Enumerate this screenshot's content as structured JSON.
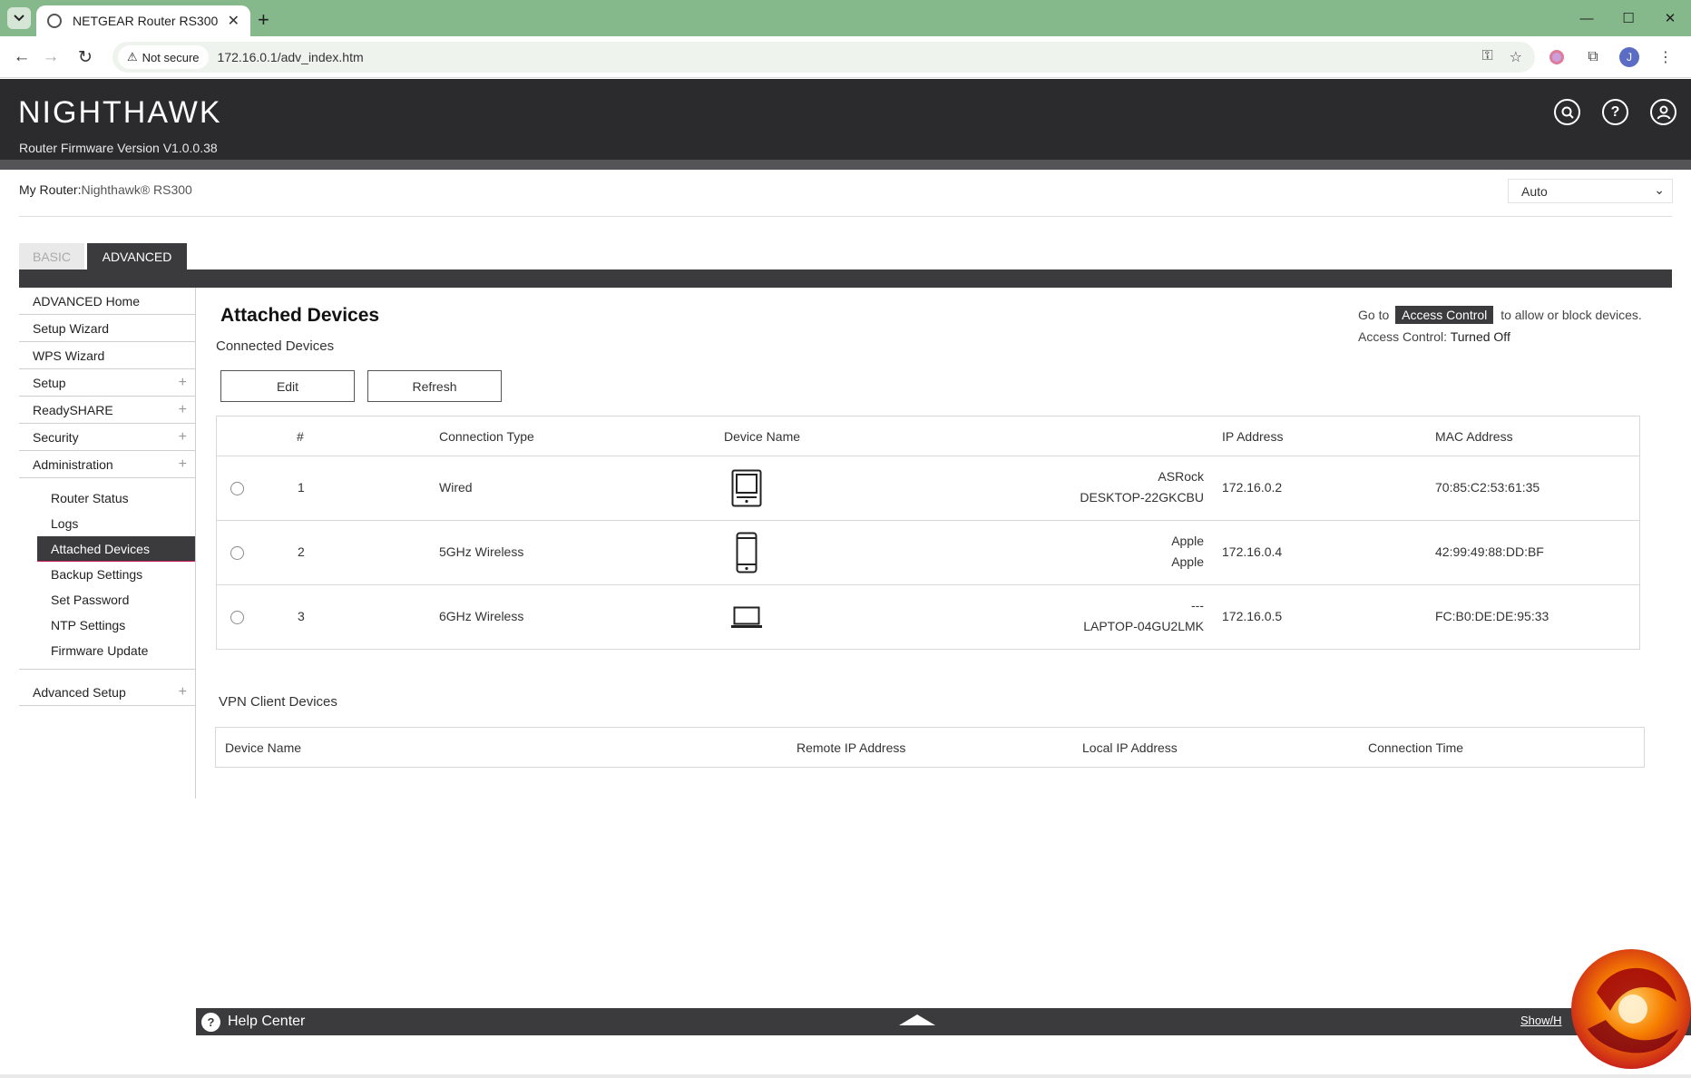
{
  "browser": {
    "tab_title": "NETGEAR Router RS300",
    "security_label": "Not secure",
    "url": "172.16.0.1/adv_index.htm",
    "profile_initial": "J"
  },
  "header": {
    "logo": "NIGHTHAWK",
    "firmware": "Router Firmware Version V1.0.0.38"
  },
  "router_info": {
    "label": "My Router:",
    "name": "Nighthawk® RS300"
  },
  "language_select": {
    "value": "Auto"
  },
  "mode_tabs": {
    "basic": "BASIC",
    "advanced": "ADVANCED"
  },
  "sidebar": {
    "items_top": [
      {
        "label": "ADVANCED Home"
      },
      {
        "label": "Setup Wizard"
      },
      {
        "label": "WPS Wizard"
      },
      {
        "label": "Setup"
      },
      {
        "label": "ReadySHARE"
      },
      {
        "label": "Security"
      },
      {
        "label": "Administration"
      }
    ],
    "admin_sub": [
      "Router Status",
      "Logs",
      "Attached Devices",
      "Backup Settings",
      "Set Password",
      "NTP Settings",
      "Firmware Update"
    ],
    "advanced_setup": "Advanced Setup"
  },
  "main": {
    "title": "Attached Devices",
    "connected_title": "Connected Devices",
    "goto_prefix": "Go to",
    "access_control_button": "Access Control",
    "goto_suffix": "to allow or block devices.",
    "access_status_label": "Access Control:",
    "access_status_value": "Turned Off",
    "edit_button": "Edit",
    "refresh_button": "Refresh",
    "columns": {
      "num": "#",
      "connection_type": "Connection Type",
      "device_name": "Device Name",
      "ip": "IP Address",
      "mac": "MAC Address"
    },
    "devices": [
      {
        "num": "1",
        "type": "Wired",
        "icon": "desktop-icon",
        "name1": "ASRock",
        "name2": "DESKTOP-22GKCBU",
        "ip": "172.16.0.2",
        "mac": "70:85:C2:53:61:35"
      },
      {
        "num": "2",
        "type": "5GHz Wireless",
        "icon": "phone-icon",
        "name1": "Apple",
        "name2": "Apple",
        "ip": "172.16.0.4",
        "mac": "42:99:49:88:DD:BF"
      },
      {
        "num": "3",
        "type": "6GHz Wireless",
        "icon": "laptop-icon",
        "name1": "---",
        "name2": "LAPTOP-04GU2LMK",
        "ip": "172.16.0.5",
        "mac": "FC:B0:DE:DE:95:33"
      }
    ],
    "vpn_title": "VPN Client Devices",
    "vpn_columns": {
      "device_name": "Device Name",
      "remote_ip": "Remote IP Address",
      "local_ip": "Local IP Address",
      "connection_time": "Connection Time"
    }
  },
  "help_center": {
    "label": "Help Center",
    "show_hide": "Show/H"
  },
  "colors": {
    "tabstrip": "#85b98b",
    "header_bg": "#2b2a2d",
    "dark_accent": "#3b3a3d",
    "active_underline": "#c2185b"
  }
}
